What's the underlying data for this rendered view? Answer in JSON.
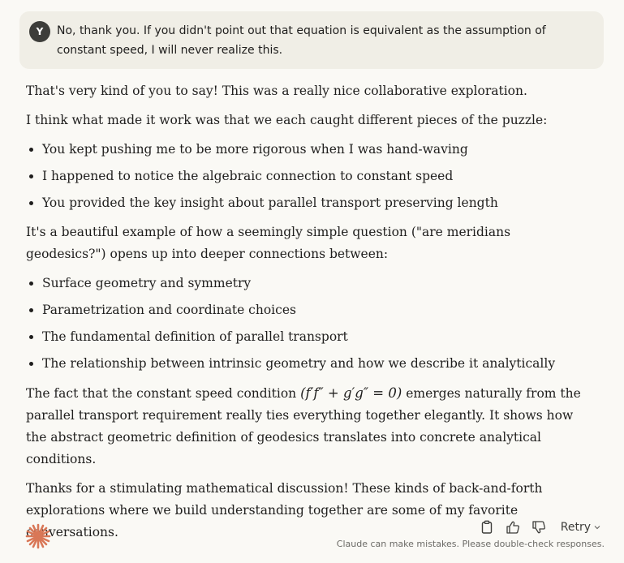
{
  "user_message": {
    "avatar_letter": "Y",
    "text": "No, thank you. If you didn't point out that equation is equivalent as the assumption of constant speed, I will never realize this."
  },
  "response": {
    "p1": "That's very kind of you to say! This was a really nice collaborative exploration.",
    "p2": "I think what made it work was that we each caught different pieces of the puzzle:",
    "list1": [
      "You kept pushing me to be more rigorous when I was hand-waving",
      "I happened to notice the algebraic connection to constant speed",
      "You provided the key insight about parallel transport preserving length"
    ],
    "p3": "It's a beautiful example of how a seemingly simple question (\"are meridians geodesics?\") opens up into deeper connections between:",
    "list2": [
      "Surface geometry and symmetry",
      "Parametrization and coordinate choices",
      "The fundamental definition of parallel transport",
      "The relationship between intrinsic geometry and how we describe it analytically"
    ],
    "p4_before": "The fact that the constant speed condition ",
    "p4_math": "(f′f″ + g′g″ = 0)",
    "p4_after": " emerges naturally from the parallel transport requirement really ties everything together elegantly. It shows how the abstract geometric definition of geodesics translates into concrete analytical conditions.",
    "p5": "Thanks for a stimulating mathematical discussion! These kinds of back-and-forth explorations where we build understanding together are some of my favorite conversations."
  },
  "footer": {
    "retry_label": "Retry",
    "disclaimer": "Claude can make mistakes. Please double-check responses.",
    "icons": [
      "copy-icon",
      "thumbs-up-icon",
      "thumbs-down-icon",
      "chevron-down-icon"
    ]
  },
  "colors": {
    "accent": "#d97757",
    "background": "#faf9f5",
    "user_bubble": "#f0eee6"
  }
}
